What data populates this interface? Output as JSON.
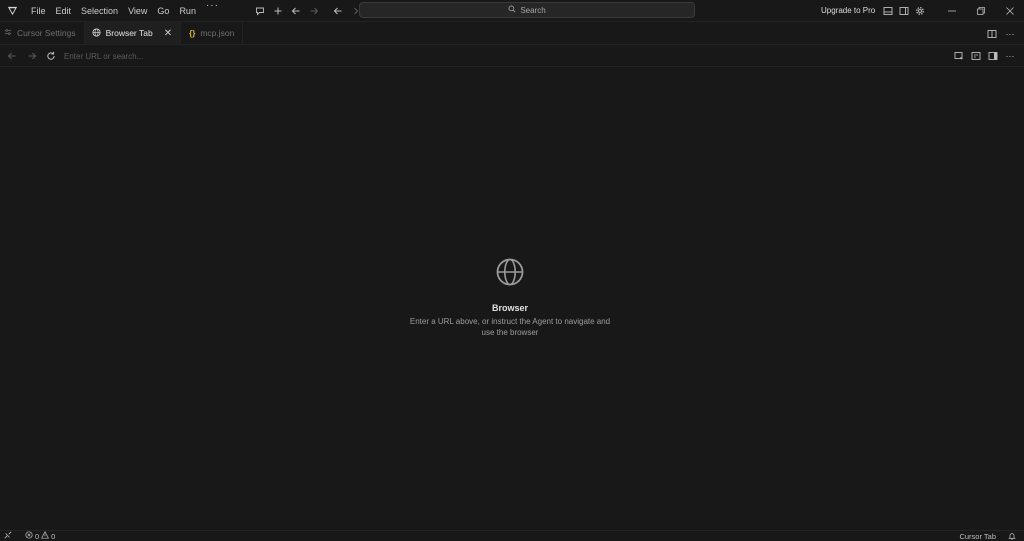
{
  "titlebar": {
    "menu": [
      "File",
      "Edit",
      "Selection",
      "View",
      "Go",
      "Run"
    ],
    "menu_more": "···",
    "search_label": "Search",
    "upgrade_label": "Upgrade to Pro"
  },
  "tabs": [
    {
      "label": "Cursor Settings",
      "icon": "settings-lines-icon",
      "active": false
    },
    {
      "label": "Browser Tab",
      "icon": "globe-icon",
      "active": true,
      "close": "✕"
    },
    {
      "label": "mcp.json",
      "icon": "json-braces-icon",
      "active": false
    }
  ],
  "browser": {
    "url_placeholder": "Enter URL or search..."
  },
  "empty_state": {
    "title": "Browser",
    "description": "Enter a URL above, or instruct the Agent to navigate and use the browser"
  },
  "statusbar": {
    "errors": "0",
    "warnings": "0",
    "cursor_tab": "Cursor Tab"
  },
  "colors": {
    "background": "#181818",
    "json_icon": "#d7ba3a"
  }
}
